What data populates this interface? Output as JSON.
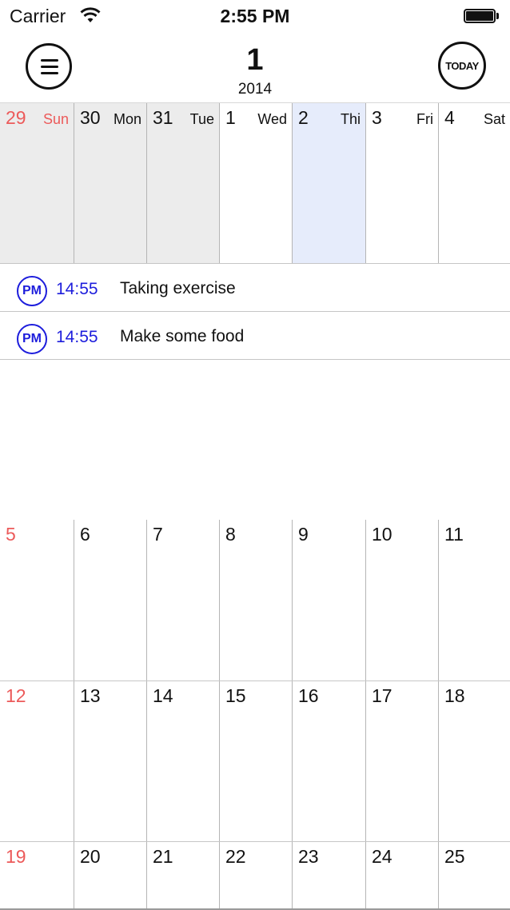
{
  "status_bar": {
    "carrier": "Carrier",
    "time": "2:55 PM"
  },
  "header": {
    "month": "1",
    "year": "2014",
    "today_label": "TODAY"
  },
  "first_week": [
    {
      "day": "29",
      "dow": "Sun"
    },
    {
      "day": "30",
      "dow": "Mon"
    },
    {
      "day": "31",
      "dow": "Tue"
    },
    {
      "day": "1",
      "dow": "Wed"
    },
    {
      "day": "2",
      "dow": "Thi"
    },
    {
      "day": "3",
      "dow": "Fri"
    },
    {
      "day": "4",
      "dow": "Sat"
    }
  ],
  "events": [
    {
      "badge": "PM",
      "time": "14:55",
      "title": "Taking exercise"
    },
    {
      "badge": "PM",
      "time": "14:55",
      "title": "Make some food"
    }
  ],
  "weeks": [
    [
      "5",
      "6",
      "7",
      "8",
      "9",
      "10",
      "11"
    ],
    [
      "12",
      "13",
      "14",
      "15",
      "16",
      "17",
      "18"
    ],
    [
      "19",
      "20",
      "21",
      "22",
      "23",
      "24",
      "25"
    ]
  ],
  "colors": {
    "sunday": "#ec5a5a",
    "accent": "#1d1ddc",
    "past_bg": "#ececec",
    "today_bg": "#e6ecfb"
  }
}
